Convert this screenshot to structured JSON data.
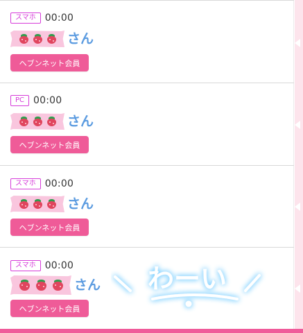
{
  "posts": [
    {
      "device": "スマホ",
      "time": "00:00",
      "nickname_suffix": "さん",
      "member_label": "ヘブンネット会員"
    },
    {
      "device": "PC",
      "time": "00:00",
      "nickname_suffix": "さん",
      "member_label": "ヘブンネット会員"
    },
    {
      "device": "スマホ",
      "time": "00:00",
      "nickname_suffix": "さん",
      "member_label": "ヘブンネット会員"
    },
    {
      "device": "スマホ",
      "time": "00:00",
      "nickname_suffix": "さん",
      "member_label": "ヘブンネット会員"
    }
  ],
  "stamp": {
    "text": "わーい"
  },
  "colors": {
    "badge": "#d63bd9",
    "member_button": "#ef5b98",
    "nickname": "#5b9be0",
    "tape": "#f9c6de",
    "sidebar": "#fde4ec",
    "bottom_bar": "#f05a9a",
    "stamp_glow": "#7fd0ff"
  },
  "icons": {
    "nickname_mask": "strawberry-icon",
    "sidebar_marker": "triangle-left-icon"
  }
}
